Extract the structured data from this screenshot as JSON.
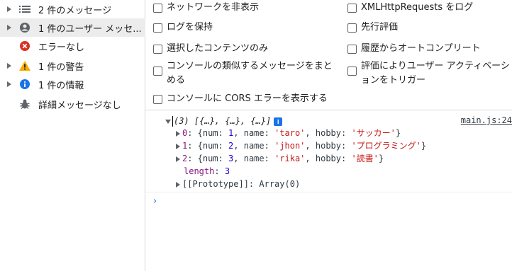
{
  "sidebar": {
    "items": [
      {
        "label": "2 件のメッセージ",
        "icon": "list-icon",
        "expandable": true,
        "selected": false
      },
      {
        "label": "1 件のユーザー メッセ...",
        "icon": "user-icon",
        "expandable": true,
        "selected": true
      },
      {
        "label": "エラーなし",
        "icon": "error-icon",
        "expandable": false,
        "selected": false
      },
      {
        "label": "1 件の警告",
        "icon": "warning-icon",
        "expandable": true,
        "selected": false
      },
      {
        "label": "1 件の情報",
        "icon": "info-icon",
        "expandable": true,
        "selected": false
      },
      {
        "label": "詳細メッセージなし",
        "icon": "bug-icon",
        "expandable": false,
        "selected": false
      }
    ]
  },
  "settings": {
    "hide_network": "ネットワークを非表示",
    "preserve_log": "ログを保持",
    "selected_context_only": "選択したコンテンツのみ",
    "group_similar": "コンソールの類似するメッセージをまとめる",
    "show_cors": "コンソールに CORS エラーを表示する",
    "log_xhr": "XMLHttpRequests をログ",
    "eager_eval": "先行評価",
    "autocomplete_history": "履歴からオートコンプリート",
    "eval_user_activation": "評価によりユーザー アクティベーションをトリガー"
  },
  "console": {
    "summary_prefix": "(3) [{…}, {…}, {…}]",
    "info_badge": "i",
    "source": "main.js:24",
    "entries": [
      {
        "index": "0",
        "num": "1",
        "name": "'taro'",
        "hobby": "'サッカー'"
      },
      {
        "index": "1",
        "num": "2",
        "name": "'jhon'",
        "hobby": "'プログラミング'"
      },
      {
        "index": "2",
        "num": "3",
        "name": "'rika'",
        "hobby": "'読書'"
      }
    ],
    "length_key": "length",
    "length_value": "3",
    "prototype_label": "[[Prototype]]",
    "prototype_value": "Array(0)",
    "prompt": "›"
  },
  "colors": {
    "error": "#d93025",
    "warning": "#f9ab00",
    "info": "#1a73e8",
    "key": "#881280",
    "string": "#c41a16",
    "number": "#1c00cf"
  }
}
